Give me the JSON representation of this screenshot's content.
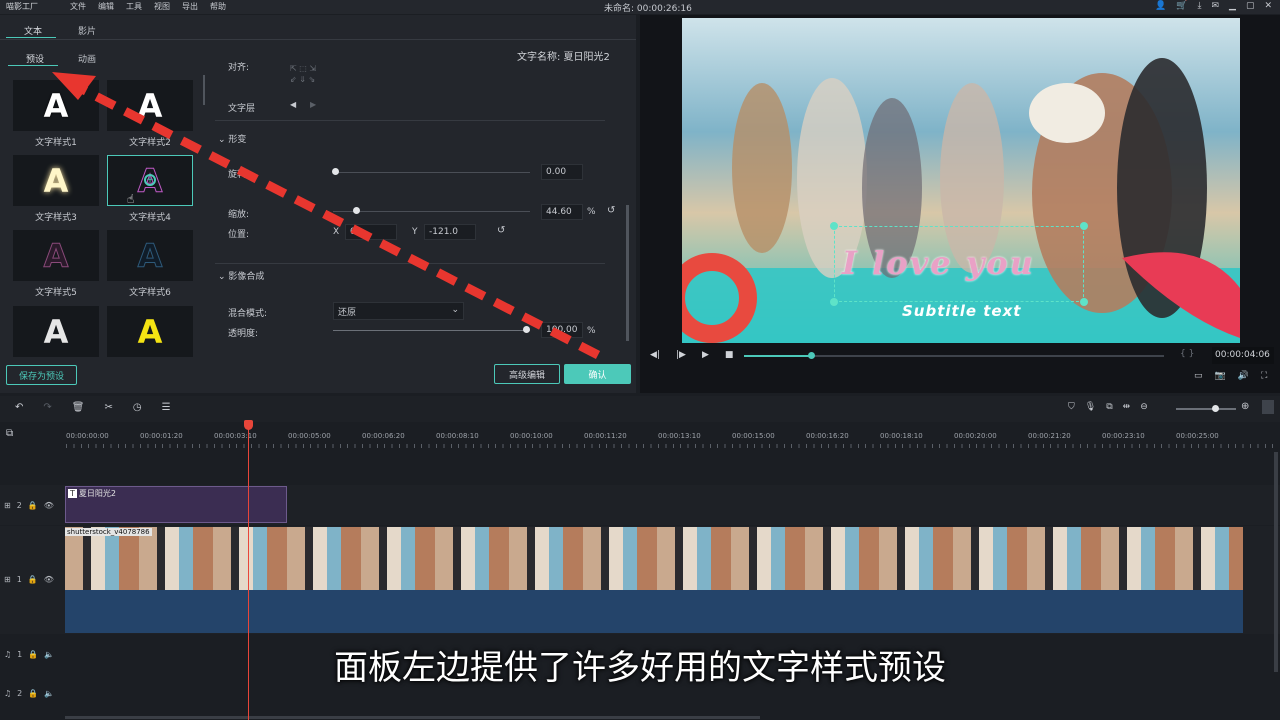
{
  "app": {
    "logo_text": "喵影工厂",
    "menu": [
      "文件",
      "编辑",
      "工具",
      "视图",
      "导出",
      "帮助"
    ],
    "project_title": "未命名: 00:00:26:16"
  },
  "left_panel": {
    "tabs": [
      "文本",
      "影片"
    ],
    "subtabs": [
      "预设",
      "动画"
    ],
    "text_name_label": "文字名称: 夏日阳光2",
    "styles": [
      {
        "label": "文字样式1",
        "letter": "A",
        "color": "#ffffff"
      },
      {
        "label": "文字样式2",
        "letter": "A",
        "color": "#ffffff"
      },
      {
        "label": "文字样式3",
        "letter": "A",
        "color": "#fff6c8"
      },
      {
        "label": "文字样式4",
        "letter": "A",
        "color": "#7a2a7e"
      },
      {
        "label": "文字样式5",
        "letter": "A",
        "color": "#4a2a4a"
      },
      {
        "label": "文字样式6",
        "letter": "A",
        "color": "#1d3b52"
      },
      {
        "label": "",
        "letter": "A",
        "color": "#e6e6e6"
      },
      {
        "label": "",
        "letter": "A",
        "color": "#f4e313"
      }
    ],
    "align_label": "对齐:",
    "layer_label": "文字层",
    "transform_header": "形变",
    "rotate_label": "旋转:",
    "rotate_value": "0.00",
    "scale_label": "缩放:",
    "scale_value": "44.60",
    "scale_unit": "%",
    "position_label": "位置:",
    "pos_x_label": "X",
    "pos_x_value": "0",
    "pos_y_label": "Y",
    "pos_y_value": "-121.0",
    "composite_header": "影像合成",
    "blend_label": "混合模式:",
    "blend_value": "还原",
    "opacity_label": "透明度:",
    "opacity_value": "100.00",
    "opacity_unit": "%",
    "save_preset": "保存为预设",
    "advanced_edit": "高级编辑",
    "confirm": "确认"
  },
  "preview": {
    "title_text": "I love you",
    "subtitle_text": "Subtitle text",
    "timecode": "00:00:04:06",
    "progress": 0.16
  },
  "timeline": {
    "ruler": [
      "00:00:00:00",
      "00:00:01:20",
      "00:00:03:10",
      "00:00:05:00",
      "00:00:06:20",
      "00:00:08:10",
      "00:00:10:00",
      "00:00:11:20",
      "00:00:13:10",
      "00:00:15:00",
      "00:00:16:20",
      "00:00:18:10",
      "00:00:20:00",
      "00:00:21:20",
      "00:00:23:10",
      "00:00:25:00"
    ],
    "text_clip": "夏日阳光2",
    "video_clip": "shutterstock_v4078786",
    "tracks": [
      "2",
      "1",
      "1",
      "2"
    ]
  },
  "caption": "面板左边提供了许多好用的文字样式预设",
  "colors": {
    "accent": "#4cc9b9",
    "arrow": "#e8362f",
    "playhead": "#e8463a"
  }
}
